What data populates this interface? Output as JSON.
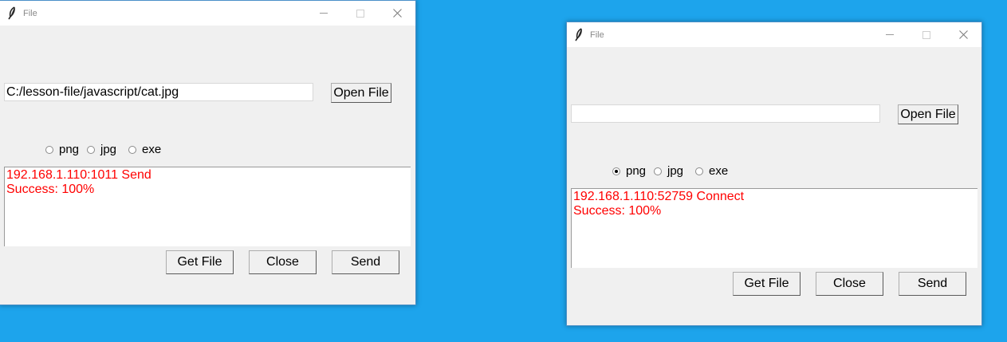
{
  "desktop": {
    "background": "#1da4ec"
  },
  "windows": [
    {
      "title": "File",
      "path_value": "C:/lesson-file/javascript/cat.jpg",
      "open_button": "Open File",
      "radios": [
        {
          "label": "png",
          "checked": false
        },
        {
          "label": "jpg",
          "checked": false
        },
        {
          "label": "exe",
          "checked": false
        }
      ],
      "log_lines": [
        "192.168.1.110:1011 Send",
        "Success: 100%"
      ],
      "buttons": {
        "get": "Get File",
        "close": "Close",
        "send": "Send"
      }
    },
    {
      "title": "File",
      "path_value": "",
      "open_button": "Open File",
      "radios": [
        {
          "label": "png",
          "checked": true
        },
        {
          "label": "jpg",
          "checked": false
        },
        {
          "label": "exe",
          "checked": false
        }
      ],
      "log_lines": [
        "192.168.1.110:52759 Connect",
        "Success: 100%"
      ],
      "buttons": {
        "get": "Get File",
        "close": "Close",
        "send": "Send"
      }
    }
  ],
  "colors": {
    "log_text": "#ff0000",
    "window_bg": "#f0f0f0"
  },
  "icons": {
    "app": "feather-icon",
    "minimize": "minimize-icon",
    "maximize": "maximize-icon",
    "close": "close-icon"
  }
}
